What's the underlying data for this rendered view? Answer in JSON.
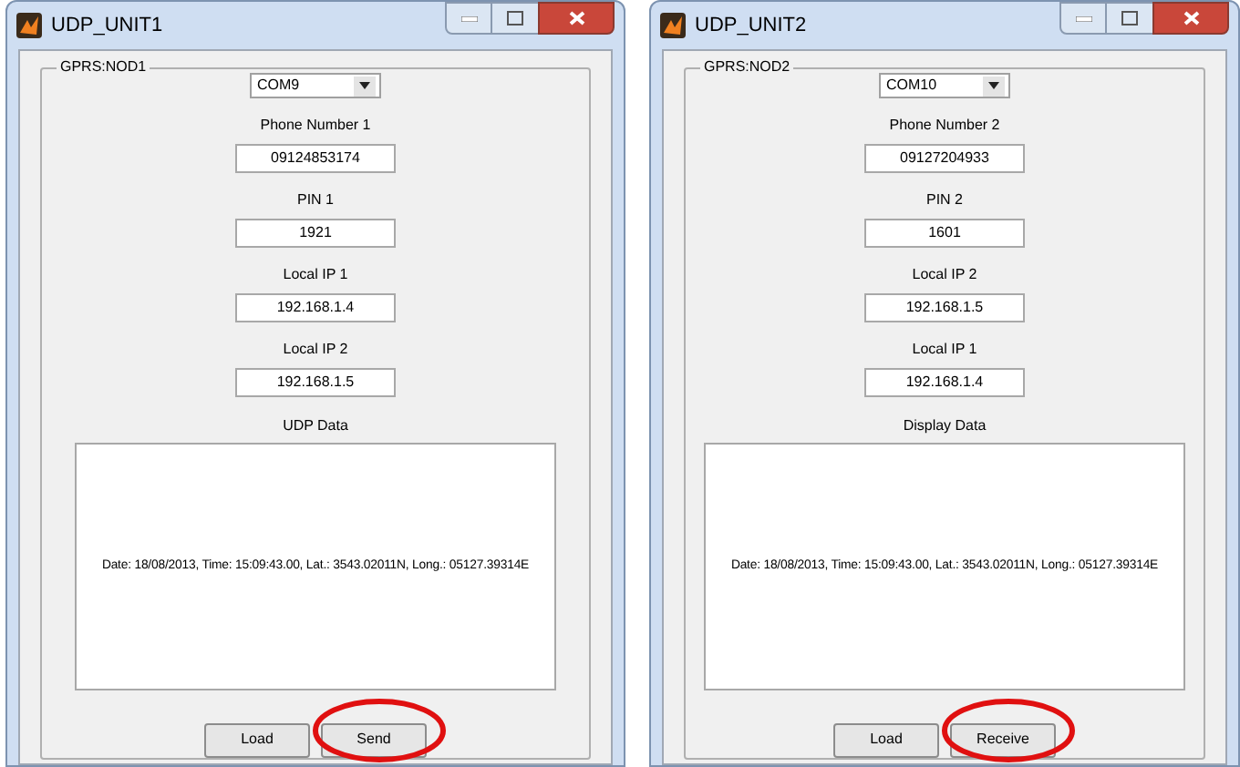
{
  "windows": [
    {
      "title": "UDP_UNIT1",
      "group_label": "GPRS:NOD1",
      "port": "COM9",
      "fields": [
        {
          "label": "Phone Number 1",
          "value": "09124853174"
        },
        {
          "label": "PIN 1",
          "value": "1921"
        },
        {
          "label": "Local IP 1",
          "value": "192.168.1.4"
        },
        {
          "label": "Local IP 2",
          "value": "192.168.1.5"
        }
      ],
      "data_label": "UDP Data",
      "data_text": "Date: 18/08/2013, Time: 15:09:43.00, Lat.: 3543.02011N, Long.: 05127.39314E",
      "buttons": [
        {
          "label": "Load",
          "circled": false
        },
        {
          "label": "Send",
          "circled": true
        }
      ]
    },
    {
      "title": "UDP_UNIT2",
      "group_label": "GPRS:NOD2",
      "port": "COM10",
      "fields": [
        {
          "label": "Phone Number 2",
          "value": "09127204933"
        },
        {
          "label": "PIN 2",
          "value": "1601"
        },
        {
          "label": "Local IP 2",
          "value": "192.168.1.5"
        },
        {
          "label": "Local IP 1",
          "value": "192.168.1.4"
        }
      ],
      "data_label": "Display Data",
      "data_text": "Date: 18/08/2013, Time: 15:09:43.00, Lat.: 3543.02011N, Long.: 05127.39314E",
      "buttons": [
        {
          "label": "Load",
          "circled": false
        },
        {
          "label": "Receive",
          "circled": true
        }
      ]
    }
  ]
}
